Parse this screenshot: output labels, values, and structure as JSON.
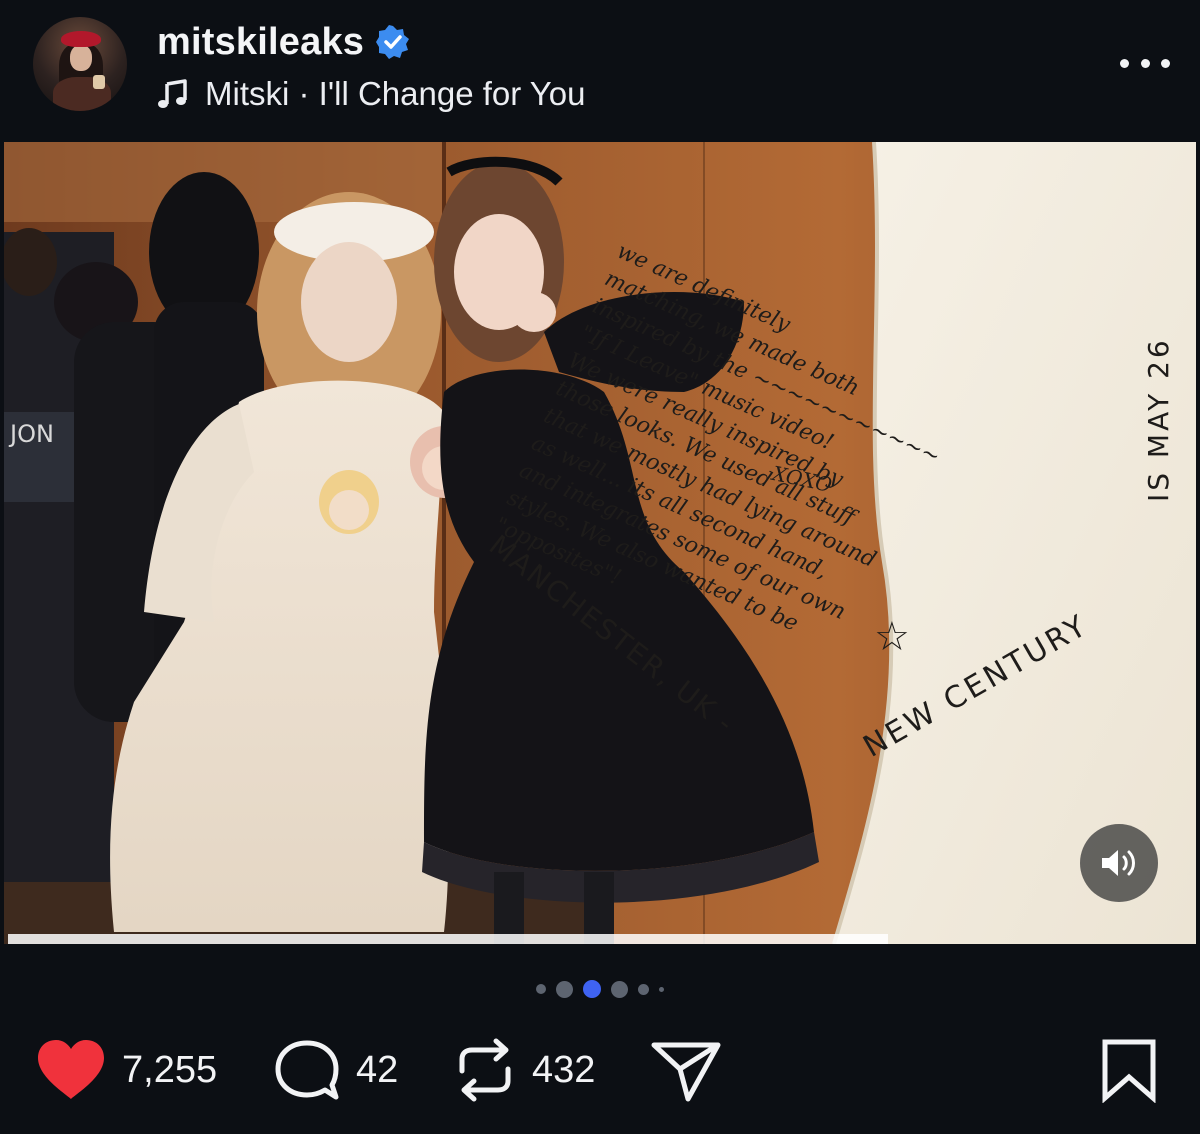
{
  "post": {
    "username": "mitskileaks",
    "verified": true,
    "song": "Mitski · I'll Change for You"
  },
  "icons": {
    "avatar": "profile-avatar",
    "verified": "verified-badge-icon",
    "music": "music-note-icon",
    "more": "more-dots-icon",
    "volume": "volume-icon",
    "like": "heart-icon",
    "comment": "comment-bubble-icon",
    "repost": "repost-icon",
    "share": "send-icon",
    "bookmark": "bookmark-icon"
  },
  "media": {
    "handwritten_note": "we are definitely\nmatching, we made both\ninspired by the ~~~~~~~~~~~\n\"If I Leave\" music video!\nWe were really inspired by\nthose looks. We used all stuff\nthat we mostly had lying around\nas well... its all second hand,\nand integrates some of our own\nstyles. We also wanted to be\n\"opposites\"!",
    "signoff": "XOXO",
    "location_line1": "MANCHESTER, UK -",
    "location_line2": "NEW CENTURY",
    "date_text": "IS MAY 26",
    "star": "☆"
  },
  "carousel": {
    "total": 6,
    "active_index": 2
  },
  "stats": {
    "likes": "7,255",
    "comments": "42",
    "reposts": "432"
  },
  "colors": {
    "background": "#0c0f14",
    "like_red": "#f0323c",
    "verified_blue": "#3c8cf0",
    "active_dot": "#3f63f2"
  }
}
